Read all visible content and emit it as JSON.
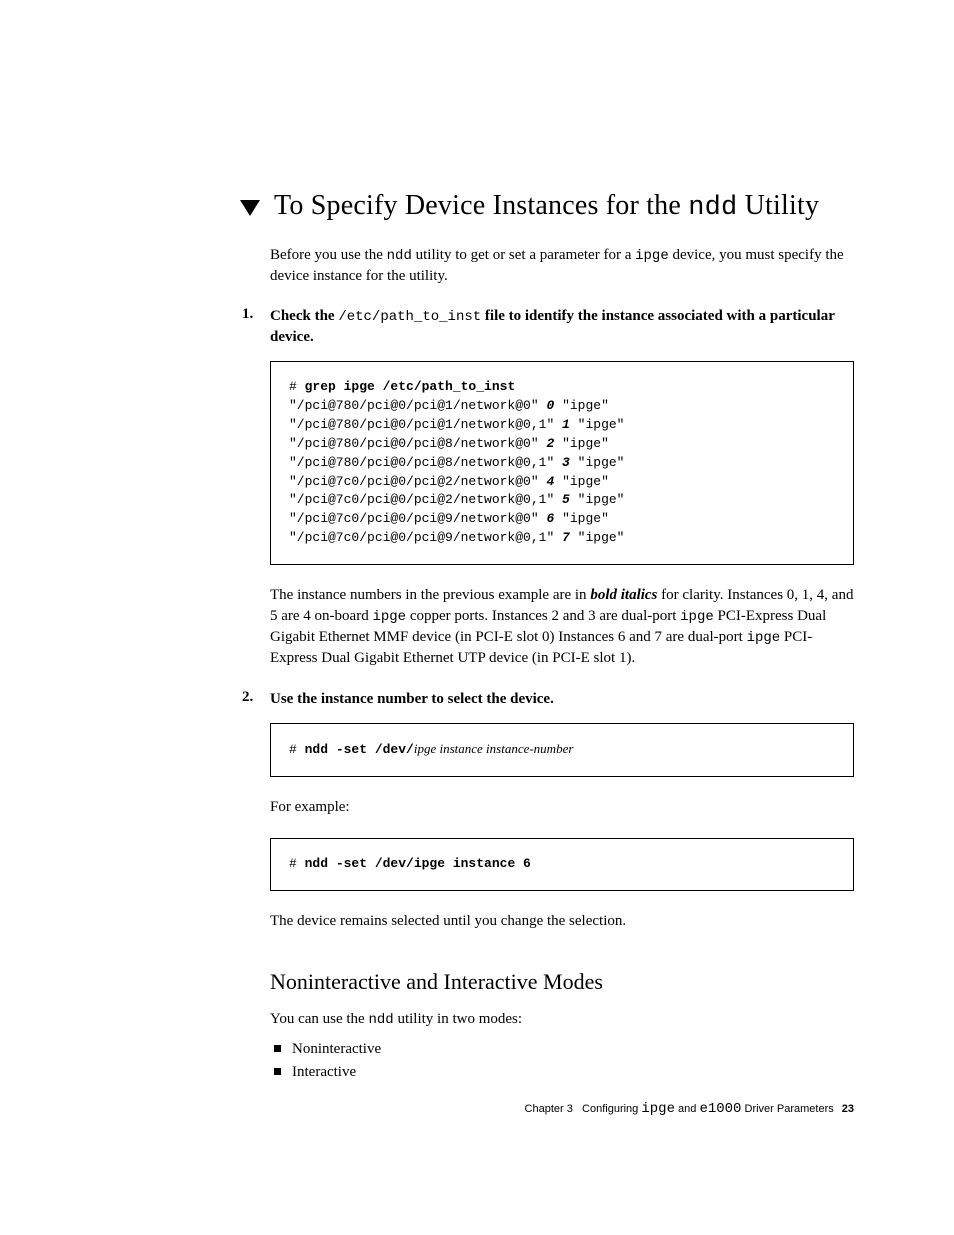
{
  "heading": {
    "pre": "To Specify Device Instances for the ",
    "mono": "ndd",
    "post": " Utility"
  },
  "intro": {
    "pre": "Before you use the ",
    "mono1": "ndd",
    "mid": " utility to get or set a parameter for a ",
    "mono2": "ipge",
    "post": " device, you must specify the device instance for the utility."
  },
  "step1": {
    "title_pre": "Check the ",
    "title_mono": "/etc/path_to_inst",
    "title_post": " file to identify the instance associated with a particular device.",
    "cmd": "grep ipge /etc/path_to_inst",
    "lines": [
      {
        "path": "\"/pci@780/pci@0/pci@1/network@0\" ",
        "inst": "0",
        "drv": " \"ipge\""
      },
      {
        "path": "\"/pci@780/pci@0/pci@1/network@0,1\" ",
        "inst": "1",
        "drv": " \"ipge\""
      },
      {
        "path": "\"/pci@780/pci@0/pci@8/network@0\" ",
        "inst": "2",
        "drv": " \"ipge\""
      },
      {
        "path": "\"/pci@780/pci@0/pci@8/network@0,1\" ",
        "inst": "3",
        "drv": " \"ipge\""
      },
      {
        "path": "\"/pci@7c0/pci@0/pci@2/network@0\" ",
        "inst": "4",
        "drv": " \"ipge\""
      },
      {
        "path": "\"/pci@7c0/pci@0/pci@2/network@0,1\" ",
        "inst": "5",
        "drv": " \"ipge\""
      },
      {
        "path": "\"/pci@7c0/pci@0/pci@9/network@0\" ",
        "inst": "6",
        "drv": " \"ipge\""
      },
      {
        "path": "\"/pci@7c0/pci@0/pci@9/network@0,1\" ",
        "inst": "7",
        "drv": " \"ipge\""
      }
    ]
  },
  "explain": {
    "pre": "The instance numbers in the previous example are in ",
    "bi": "bold italics",
    "mid1": " for clarity. Instances 0, 1, 4, and 5 are 4 on-board ",
    "mono1": "ipge",
    "mid2": " copper ports. Instances 2 and 3 are dual-port ",
    "mono2": "ipge",
    "mid3": " PCI-Express Dual Gigabit Ethernet MMF device (in PCI-E slot 0) Instances 6 and 7 are dual-port ",
    "mono3": "ipge",
    "post": " PCI-Express Dual Gigabit Ethernet UTP device (in PCI-E slot 1)."
  },
  "step2": {
    "title": "Use the instance number to select the device.",
    "cmd": "ndd -set /dev/",
    "ital": "ipge instance instance-number",
    "for_example": "For example:",
    "ex_cmd": "ndd -set /dev/ipge instance 6",
    "remains": "The device remains selected until you change the selection."
  },
  "sub": {
    "heading": "Noninteractive and Interactive Modes",
    "intro_pre": "You can use the ",
    "intro_mono": "ndd",
    "intro_post": " utility in two modes:",
    "items": [
      "Noninteractive",
      "Interactive"
    ]
  },
  "footer": {
    "chapter": "Chapter 3",
    "title_pre": "Configuring ",
    "mono1": "ipge",
    "mid": " and ",
    "mono2": "e1000",
    "title_post": " Driver Parameters",
    "page": "23"
  }
}
